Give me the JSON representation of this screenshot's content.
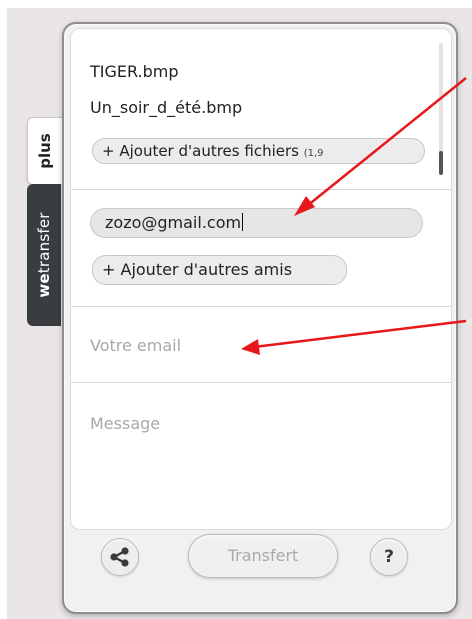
{
  "side_tabs": {
    "plus": "plus",
    "brand_bold": "we",
    "brand_rest": "transfer"
  },
  "files": [
    "TIGER.bmp",
    "Un_soir_d_été.bmp"
  ],
  "add_files": {
    "label": "+ Ajouter d'autres fichiers",
    "size_note": "(1,9"
  },
  "recipients": {
    "email": "zozo@gmail.com",
    "add_friends_label": "+ Ajouter d'autres amis"
  },
  "your_email_placeholder": "Votre email",
  "message_placeholder": "Message",
  "footer": {
    "transfer_label": "Transfert",
    "help_label": "?",
    "share_icon": "share-icon"
  },
  "colors": {
    "annotation_arrow": "#e8171a",
    "brand_tab": "#3a3d40"
  }
}
